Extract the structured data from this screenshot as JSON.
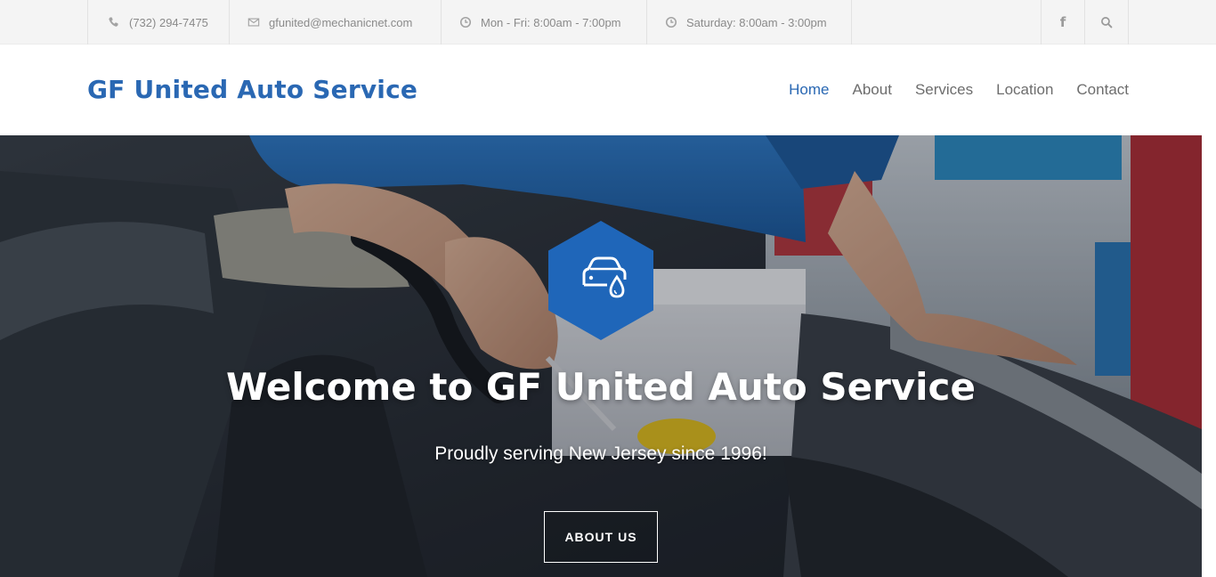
{
  "topbar": {
    "phone": "(732) 294-7475",
    "email": "gfunited@mechanicnet.com",
    "weekday_hours": "Mon - Fri: 8:00am - 7:00pm",
    "saturday_hours": "Saturday: 8:00am - 3:00pm",
    "facebook_icon": "f"
  },
  "header": {
    "brand": "GF United Auto Service",
    "nav": [
      "Home",
      "About",
      "Services",
      "Location",
      "Contact"
    ],
    "active": "Home"
  },
  "hero": {
    "title": "Welcome to GF United Auto Service",
    "subtitle": "Proudly serving New Jersey since 1996!",
    "button_label": "ABOUT US",
    "badge_icon": "car-oil-icon"
  },
  "colors": {
    "brand_blue": "#2a68b3",
    "badge_blue": "#1f66b9",
    "topbar_bg": "#f4f4f4",
    "topbar_text": "#8a8a8a",
    "nav_text": "#6d6d6d"
  }
}
